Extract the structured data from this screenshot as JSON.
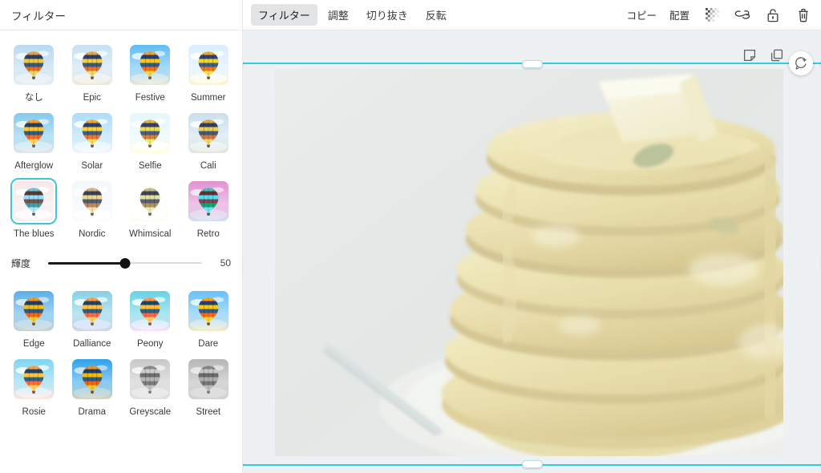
{
  "left_panel": {
    "header_title": "フィルター",
    "slider": {
      "label": "輝度",
      "value": "50",
      "percent": 50
    },
    "filters_row_top": [
      {
        "name": "なし",
        "icon": "balloon-thumb",
        "sky": "#b9d9ef",
        "ground": "#e9eef2",
        "selected": false,
        "sat": 1.0,
        "hue": 0,
        "bright": 1.0
      },
      {
        "name": "Epic",
        "icon": "balloon-thumb",
        "sky": "#c3dcef",
        "ground": "#ece5cf",
        "selected": false,
        "sat": 0.95,
        "hue": 0,
        "bright": 1.02
      },
      {
        "name": "Festive",
        "icon": "balloon-thumb",
        "sky": "#6fb9e4",
        "ground": "#f0ead4",
        "selected": false,
        "sat": 1.25,
        "hue": 0,
        "bright": 1.0
      },
      {
        "name": "Summer",
        "icon": "balloon-thumb",
        "sky": "#cfe3f1",
        "ground": "#f4e9c6",
        "selected": false,
        "sat": 1.1,
        "hue": 6,
        "bright": 1.05
      },
      {
        "name": "Afterglow",
        "icon": "balloon-thumb",
        "sky": "#8dc7ea",
        "ground": "#e2e8ea",
        "selected": false,
        "sat": 1.15,
        "hue": -4,
        "bright": 1.0
      },
      {
        "name": "Solar",
        "icon": "balloon-thumb",
        "sky": "#a8d4ef",
        "ground": "#eceef0",
        "selected": false,
        "sat": 1.05,
        "hue": 0,
        "bright": 1.04
      },
      {
        "name": "Selfie",
        "icon": "balloon-thumb",
        "sky": "#cfe6e7",
        "ground": "#f6ecc6",
        "selected": false,
        "sat": 0.85,
        "hue": 10,
        "bright": 1.08
      },
      {
        "name": "Cali",
        "icon": "balloon-thumb",
        "sky": "#c2dced",
        "ground": "#dfe0d6",
        "selected": false,
        "sat": 0.8,
        "hue": 0,
        "bright": 1.02
      },
      {
        "name": "The blues",
        "icon": "balloon-thumb",
        "sky": "#cfe0ea",
        "ground": "#dde4e4",
        "selected": true,
        "sat": 0.55,
        "hue": 150,
        "bright": 1.06
      },
      {
        "name": "Nordic",
        "icon": "balloon-thumb",
        "sky": "#dbe6ee",
        "ground": "#e8eaea",
        "selected": false,
        "sat": 0.45,
        "hue": 0,
        "bright": 1.08
      },
      {
        "name": "Whimsical",
        "icon": "balloon-thumb",
        "sky": "#ece3dd",
        "ground": "#f2ddc8",
        "selected": false,
        "sat": 0.4,
        "hue": 18,
        "bright": 1.12
      },
      {
        "name": "Retro",
        "icon": "balloon-thumb",
        "sky": "#5cc0bd",
        "ground": "#dde9c9",
        "selected": false,
        "sat": 0.9,
        "hue": 130,
        "bright": 0.98
      }
    ],
    "filters_row_bottom": [
      {
        "name": "Edge",
        "icon": "balloon-thumb",
        "sky": "#6fb3e0",
        "ground": "#d7dedd",
        "selected": false,
        "sat": 1.3,
        "hue": 0,
        "bright": 0.96
      },
      {
        "name": "Dalliance",
        "icon": "balloon-thumb",
        "sky": "#93c6ea",
        "ground": "#d5cfe6",
        "selected": false,
        "sat": 1.1,
        "hue": -16,
        "bright": 1.02
      },
      {
        "name": "Peony",
        "icon": "balloon-thumb",
        "sky": "#7fc0ea",
        "ground": "#f6d7e6",
        "selected": false,
        "sat": 1.2,
        "hue": -20,
        "bright": 1.04
      },
      {
        "name": "Dare",
        "icon": "balloon-thumb",
        "sky": "#79bce7",
        "ground": "#f6eccb",
        "selected": false,
        "sat": 1.35,
        "hue": 0,
        "bright": 1.0
      },
      {
        "name": "Rosie",
        "icon": "balloon-thumb",
        "sky": "#8cc7ea",
        "ground": "#f7ded0",
        "selected": false,
        "sat": 1.15,
        "hue": -10,
        "bright": 1.04
      },
      {
        "name": "Drama",
        "icon": "balloon-thumb",
        "sky": "#4ea6dd",
        "ground": "#e7e6cd",
        "selected": false,
        "sat": 1.4,
        "hue": 0,
        "bright": 0.94
      },
      {
        "name": "Greyscale",
        "icon": "balloon-thumb",
        "sky": "#c8c8c8",
        "ground": "#e2e2e2",
        "selected": false,
        "sat": 0.0,
        "hue": 0,
        "bright": 1.0
      },
      {
        "name": "Street",
        "icon": "balloon-thumb",
        "sky": "#bdbdbd",
        "ground": "#dcdcdc",
        "selected": false,
        "sat": 0.0,
        "hue": 0,
        "bright": 0.96
      }
    ]
  },
  "toolbar": {
    "tabs": [
      {
        "label": "フィルター",
        "active": true
      },
      {
        "label": "調整",
        "active": false
      },
      {
        "label": "切り抜き",
        "active": false
      },
      {
        "label": "反転",
        "active": false
      }
    ],
    "copy_label": "コピー",
    "arrange_label": "配置",
    "icons": [
      {
        "name": "transparency-icon"
      },
      {
        "name": "link-icon"
      },
      {
        "name": "lock-icon"
      },
      {
        "name": "trash-icon"
      }
    ]
  },
  "canvas": {
    "float_icons": [
      {
        "name": "note-icon"
      },
      {
        "name": "duplicate-icon"
      }
    ],
    "rotate_icon": "rotate-comment-icon",
    "selection": {
      "accent_color": "#2ed0e0",
      "handle_fill": "#ffffff"
    },
    "photo": {
      "alt": "pancake-stack-photo",
      "background": "#dfe3e4"
    }
  }
}
